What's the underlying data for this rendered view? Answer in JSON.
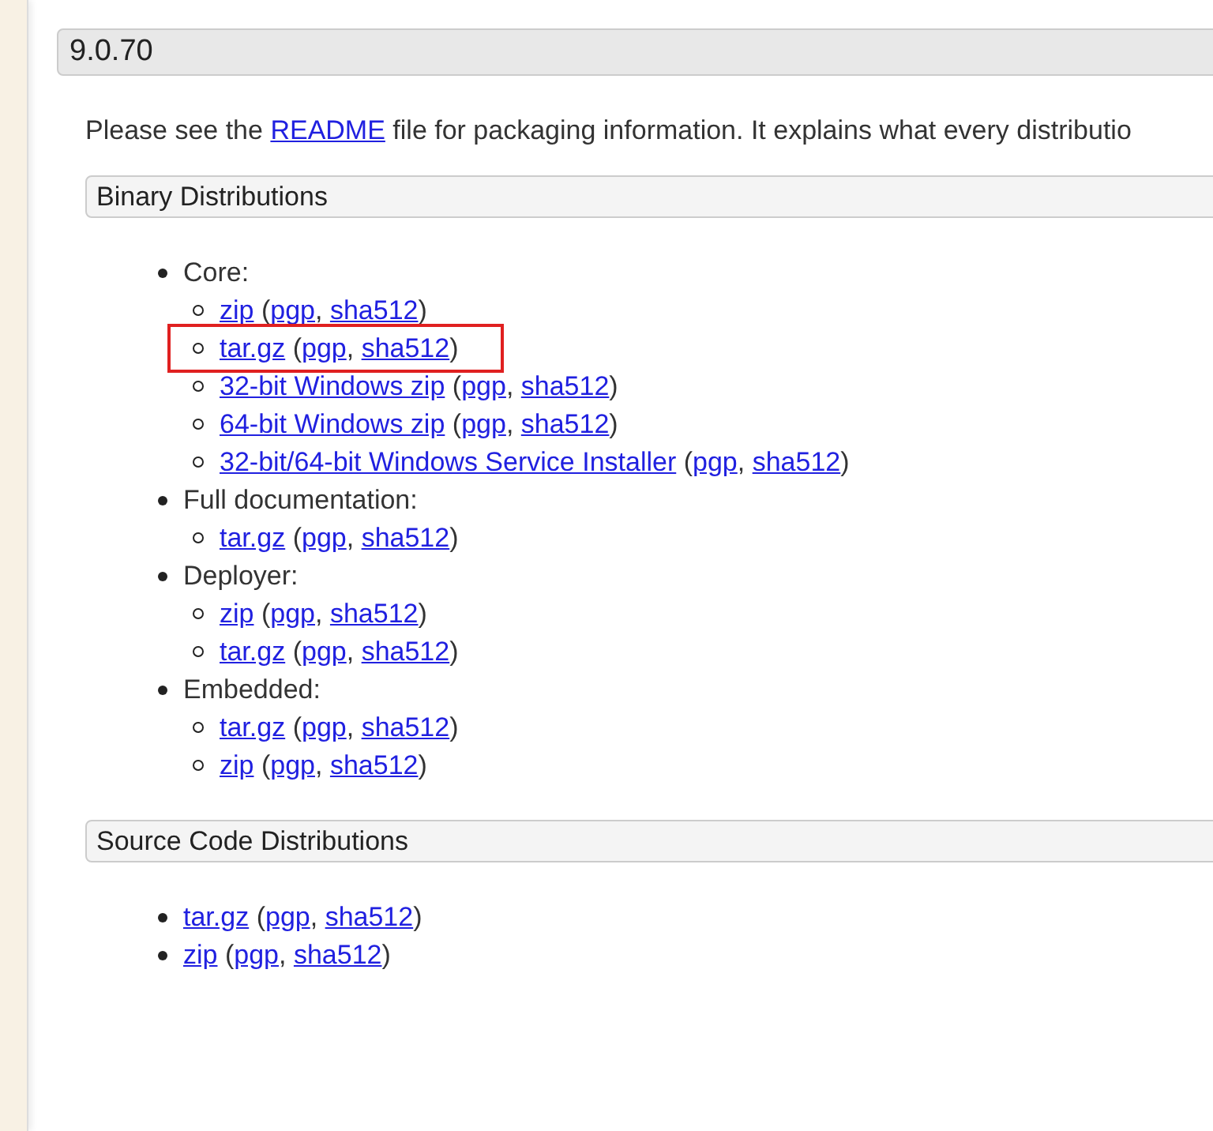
{
  "version_heading": "9.0.70",
  "intro": {
    "before": "Please see the ",
    "link": "README",
    "after": " file for packaging information. It explains what every distributio"
  },
  "sections": [
    {
      "title": "Binary Distributions",
      "groups": [
        {
          "label": "Core:",
          "files": [
            {
              "name": "zip",
              "open": "(",
              "signatures": [
                "pgp",
                "sha512"
              ],
              "separator": ", ",
              "close": ")",
              "highlighted": false
            },
            {
              "name": "tar.gz",
              "open": "(",
              "signatures": [
                "pgp",
                "sha512"
              ],
              "separator": ", ",
              "close": ")",
              "highlighted": true
            },
            {
              "name": "32-bit Windows zip",
              "open": "(",
              "signatures": [
                "pgp",
                "sha512"
              ],
              "separator": ", ",
              "close": ")",
              "highlighted": false
            },
            {
              "name": "64-bit Windows zip",
              "open": "(",
              "signatures": [
                "pgp",
                "sha512"
              ],
              "separator": ", ",
              "close": ")",
              "highlighted": false
            },
            {
              "name": "32-bit/64-bit Windows Service Installer",
              "open": "(",
              "signatures": [
                "pgp",
                "sha512"
              ],
              "separator": ", ",
              "close": ")",
              "highlighted": false
            }
          ]
        },
        {
          "label": "Full documentation:",
          "files": [
            {
              "name": "tar.gz",
              "open": "(",
              "signatures": [
                "pgp",
                "sha512"
              ],
              "separator": ", ",
              "close": ")",
              "highlighted": false
            }
          ]
        },
        {
          "label": "Deployer:",
          "files": [
            {
              "name": "zip",
              "open": "(",
              "signatures": [
                "pgp",
                "sha512"
              ],
              "separator": ", ",
              "close": ")",
              "highlighted": false
            },
            {
              "name": "tar.gz",
              "open": "(",
              "signatures": [
                "pgp",
                "sha512"
              ],
              "separator": ", ",
              "close": ")",
              "highlighted": false
            }
          ]
        },
        {
          "label": "Embedded:",
          "files": [
            {
              "name": "tar.gz",
              "open": "(",
              "signatures": [
                "pgp",
                "sha512"
              ],
              "separator": ", ",
              "close": ")",
              "highlighted": false
            },
            {
              "name": "zip",
              "open": "(",
              "signatures": [
                "pgp",
                "sha512"
              ],
              "separator": ", ",
              "close": ")",
              "highlighted": false
            }
          ]
        }
      ]
    },
    {
      "title": "Source Code Distributions",
      "files": [
        {
          "name": "tar.gz",
          "open": "(",
          "signatures": [
            "pgp",
            "sha512"
          ],
          "separator": ", ",
          "close": ")",
          "highlighted": false
        },
        {
          "name": "zip",
          "open": "(",
          "signatures": [
            "pgp",
            "sha512"
          ],
          "separator": ", ",
          "close": ")",
          "highlighted": false
        }
      ]
    }
  ]
}
